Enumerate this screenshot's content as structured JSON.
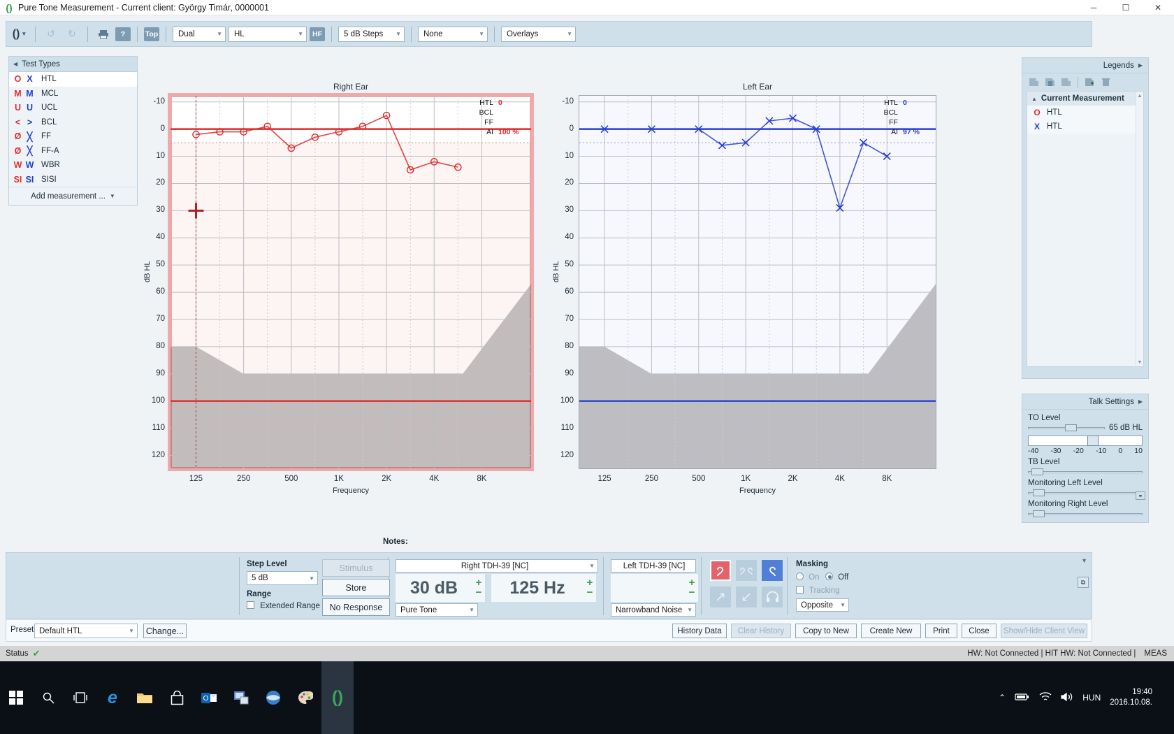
{
  "window": {
    "title": "Pure Tone Measurement - Current client: György Timár, 0000001",
    "minimize": "─",
    "maximize": "☐",
    "close": "✕"
  },
  "toolbar": {
    "app_icon": "audiometer-icon",
    "undo": "↺",
    "redo": "↻",
    "print": "⎙",
    "help": "?",
    "top_button": "Top",
    "hf_button": "HF",
    "dropdowns": [
      {
        "name": "view-mode",
        "value": "Dual"
      },
      {
        "name": "scale-type",
        "value": "HL"
      },
      {
        "name": "step-size",
        "value": "5 dB Steps"
      },
      {
        "name": "norm-curve",
        "value": "None"
      },
      {
        "name": "overlays",
        "value": "Overlays"
      }
    ]
  },
  "test_types": {
    "header": "Test Types",
    "items": [
      {
        "label": "HTL",
        "right": "O",
        "left": "X",
        "selected": true
      },
      {
        "label": "MCL",
        "right": "M",
        "left": "M",
        "selected": false
      },
      {
        "label": "UCL",
        "right": "U",
        "left": "U",
        "selected": false
      },
      {
        "label": "BCL",
        "right": "<",
        "left": ">",
        "selected": false
      },
      {
        "label": "FF",
        "right": "Ø",
        "left": "╳",
        "selected": false
      },
      {
        "label": "FF-A",
        "right": "Ø",
        "left": "╳",
        "selected": false
      },
      {
        "label": "WBR",
        "right": "W",
        "left": "W",
        "selected": false
      },
      {
        "label": "SISI",
        "right": "SI",
        "left": "SI",
        "selected": false
      }
    ],
    "add_measurement": "Add measurement ..."
  },
  "chart_data": [
    {
      "type": "line",
      "title": "Right Ear",
      "xlabel": "Frequency",
      "ylabel": "dB HL",
      "categories": [
        "125",
        "250",
        "500",
        "1K",
        "2K",
        "4K",
        "8K"
      ],
      "x_ticks": [
        "125",
        "250",
        "500",
        "1K",
        "2K",
        "4K",
        "8K"
      ],
      "y_ticks": [
        "-10",
        "0",
        "10",
        "20",
        "30",
        "40",
        "50",
        "60",
        "70",
        "80",
        "90",
        "100",
        "110",
        "120"
      ],
      "ylim": [
        -10,
        125
      ],
      "grid": true,
      "series": [
        {
          "name": "HTL",
          "symbol": "O",
          "color": "#e02a2a",
          "x": [
            "125",
            "180",
            "250",
            "375",
            "500",
            "750",
            "1K",
            "1.5K",
            "2K",
            "3K",
            "4K",
            "6K",
            "8K"
          ],
          "values": [
            2,
            1,
            1,
            -1,
            7,
            3,
            1,
            -1,
            -5,
            15,
            12,
            14,
            null
          ]
        }
      ],
      "legend_rows": [
        {
          "label": "HTL",
          "value": "0"
        },
        {
          "label": "BCL",
          "value": ""
        },
        {
          "label": "FF",
          "value": ""
        },
        {
          "label": "AI",
          "value": "100 %"
        }
      ],
      "cursor": {
        "frequency": "125",
        "level": "30"
      }
    },
    {
      "type": "line",
      "title": "Left Ear",
      "xlabel": "Frequency",
      "ylabel": "dB HL",
      "categories": [
        "125",
        "250",
        "500",
        "1K",
        "2K",
        "4K",
        "8K"
      ],
      "x_ticks": [
        "125",
        "250",
        "500",
        "1K",
        "2K",
        "4K",
        "8K"
      ],
      "y_ticks": [
        "-10",
        "0",
        "10",
        "20",
        "30",
        "40",
        "50",
        "60",
        "70",
        "80",
        "90",
        "100",
        "110",
        "120"
      ],
      "ylim": [
        -10,
        125
      ],
      "grid": true,
      "series": [
        {
          "name": "HTL",
          "symbol": "X",
          "color": "#2a3fd0",
          "x": [
            "125",
            "250",
            "500",
            "750",
            "1K",
            "1.5K",
            "2K",
            "3K",
            "4K",
            "6K",
            "8K"
          ],
          "values": [
            0,
            0,
            0,
            6,
            5,
            -3,
            -4,
            0,
            29,
            5,
            10
          ]
        }
      ],
      "legend_rows": [
        {
          "label": "HTL",
          "value": "0"
        },
        {
          "label": "BCL",
          "value": ""
        },
        {
          "label": "FF",
          "value": ""
        },
        {
          "label": "AI",
          "value": "97 %"
        }
      ]
    }
  ],
  "legends_panel": {
    "header": "Legends",
    "tools": [
      "new-legend-icon",
      "delete-legend-icon",
      "copy-legend-icon",
      "add-row-icon",
      "trash-icon"
    ],
    "group": "Current Measurement",
    "items": [
      {
        "symbol": "O",
        "label": "HTL",
        "color": "#e02a2a"
      },
      {
        "symbol": "X",
        "label": "HTL",
        "color": "#2a3fd0"
      }
    ]
  },
  "talk_settings": {
    "header": "Talk Settings",
    "to_level_label": "TO Level",
    "to_level_value": "65 dB HL",
    "scale_ticks": [
      "-40",
      "-30",
      "-20",
      "-10",
      "0",
      "10"
    ],
    "tb_level_label": "TB Level",
    "monitor_left_label": "Monitoring Left Level",
    "monitor_right_label": "Monitoring Right Level"
  },
  "notes": {
    "label": "Notes:"
  },
  "controls": {
    "step_level_label": "Step Level",
    "step_level_value": "5 dB",
    "range_label": "Range",
    "extended_range_label": "Extended Range",
    "extended_range_checked": false,
    "stimulus_button": "Stimulus",
    "store_button": "Store",
    "no_response_button": "No Response",
    "right_transducer": "Right TDH-39 [NC]",
    "left_transducer": "Left TDH-39 [NC]",
    "level_value": "30 dB",
    "frequency_value": "125 Hz",
    "stimulus_type": "Pure Tone",
    "masking_type": "Narrowband Noise",
    "plus": "+",
    "minus": "−",
    "ear_buttons": [
      {
        "name": "right-ear-button",
        "glyph": "ʕ",
        "state": "active-right"
      },
      {
        "name": "both-ears-button",
        "glyph": "ʕʔ",
        "state": "inactive"
      },
      {
        "name": "left-ear-button",
        "glyph": "ʔ",
        "state": "active-left"
      },
      {
        "name": "route-right-button",
        "glyph": "↗",
        "state": "inactive"
      },
      {
        "name": "route-left-button",
        "glyph": "↙",
        "state": "inactive"
      },
      {
        "name": "headphone-button",
        "glyph": "⌂",
        "state": "inactive"
      }
    ],
    "masking_label": "Masking",
    "masking_on": "On",
    "masking_off": "Off",
    "masking_selected": "Off",
    "tracking_label": "Tracking",
    "tracking_checked": false,
    "masking_side": "Opposite"
  },
  "preset_bar": {
    "label": "Preset",
    "value": "Default HTL",
    "change_button": "Change..."
  },
  "footer_buttons": [
    {
      "label": "History Data",
      "disabled": false
    },
    {
      "label": "Clear History",
      "disabled": true
    },
    {
      "label": "Copy to New",
      "disabled": false
    },
    {
      "label": "Create New",
      "disabled": false
    },
    {
      "label": "Print",
      "disabled": false
    },
    {
      "label": "Close",
      "disabled": false
    },
    {
      "label": "Show/Hide Client View",
      "disabled": true
    }
  ],
  "status_bar": {
    "label": "Status",
    "hw": "HW:  Not Connected  |  HIT HW:  Not Connected  |",
    "mode": "MEAS"
  },
  "taskbar": {
    "items": [
      {
        "name": "start-button",
        "glyph": "⊞"
      },
      {
        "name": "search-icon",
        "glyph": "⚲"
      },
      {
        "name": "task-view-icon",
        "glyph": "❑"
      },
      {
        "name": "edge-icon",
        "glyph": "e"
      },
      {
        "name": "file-explorer-icon",
        "glyph": "Ὄ1"
      },
      {
        "name": "store-icon",
        "glyph": "Ὤd"
      },
      {
        "name": "outlook-icon",
        "glyph": "O"
      },
      {
        "name": "remote-desktop-icon",
        "glyph": "Ὓ5"
      },
      {
        "name": "browser-icon",
        "glyph": "◐"
      },
      {
        "name": "paint-icon",
        "glyph": "Ἲ8"
      },
      {
        "name": "audiometer-app-icon",
        "glyph": "()"
      }
    ],
    "tray": [
      "chevron-up-icon",
      "battery-icon",
      "wifi-icon",
      "volume-icon"
    ],
    "language": "HUN",
    "time": "19:40",
    "date": "2016.10.08."
  }
}
